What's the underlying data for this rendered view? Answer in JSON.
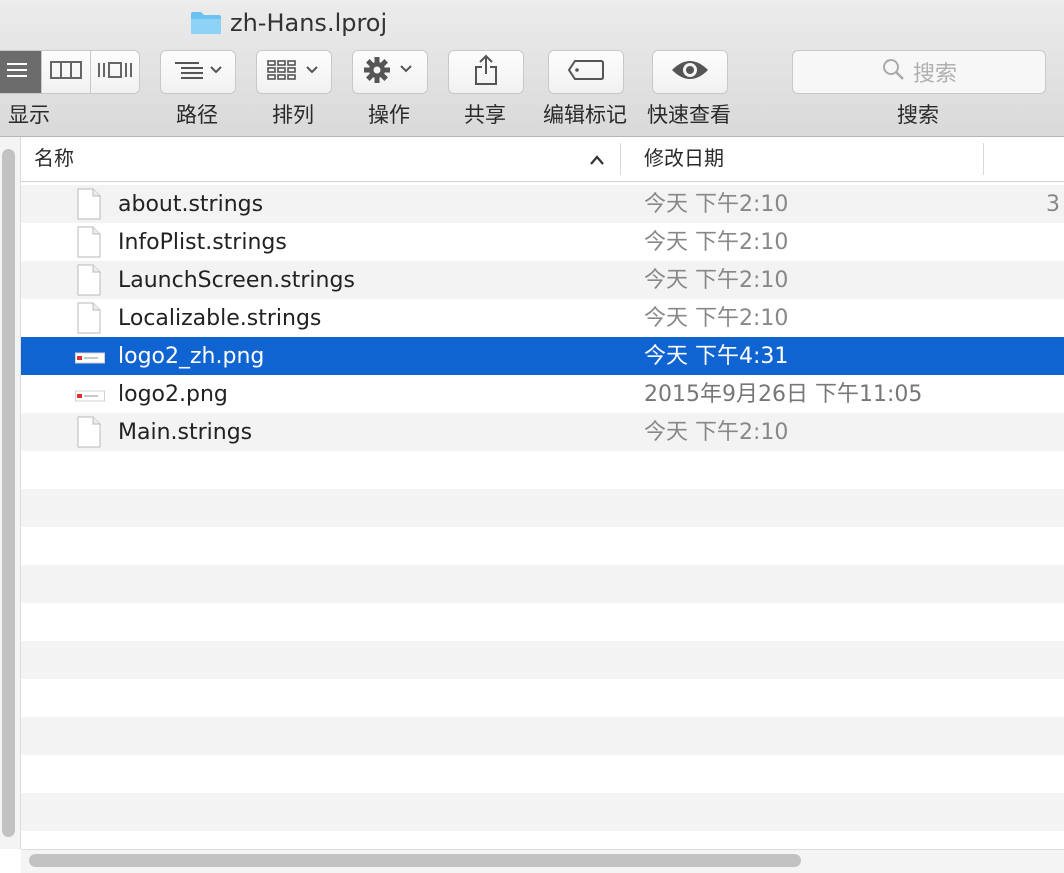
{
  "window": {
    "title": "zh-Hans.lproj"
  },
  "toolbar": {
    "view": {
      "label": "显示",
      "modes": [
        "list-view-icon",
        "column-view-icon",
        "coverflow-view-icon"
      ],
      "active_index": 0
    },
    "path": {
      "label": "路径",
      "icon": "path-list-icon"
    },
    "arrange": {
      "label": "排列",
      "icon": "grid-arrange-icon"
    },
    "action": {
      "label": "操作",
      "icon": "gear-icon"
    },
    "share": {
      "label": "共享",
      "icon": "share-icon"
    },
    "tags": {
      "label": "编辑标记",
      "icon": "tag-icon"
    },
    "quicklook": {
      "label": "快速查看",
      "icon": "eye-icon"
    },
    "search": {
      "label": "搜索",
      "placeholder": "搜索"
    }
  },
  "columns": {
    "name": "名称",
    "date": "修改日期",
    "sort": "ascending"
  },
  "files": [
    {
      "name": "about.strings",
      "date": "今天 下午2:10",
      "type": "document",
      "size_partial": "3"
    },
    {
      "name": "InfoPlist.strings",
      "date": "今天 下午2:10",
      "type": "document"
    },
    {
      "name": "LaunchScreen.strings",
      "date": "今天 下午2:10",
      "type": "document"
    },
    {
      "name": "Localizable.strings",
      "date": "今天 下午2:10",
      "type": "document"
    },
    {
      "name": "logo2_zh.png",
      "date": "今天 下午4:31",
      "type": "image",
      "selected": true
    },
    {
      "name": "logo2.png",
      "date": "2015年9月26日 下午11:05",
      "type": "image"
    },
    {
      "name": "Main.strings",
      "date": "今天 下午2:10",
      "type": "document"
    }
  ],
  "colors": {
    "selection": "#0f64d2",
    "folder": "#6cc1f0",
    "stripe": "#f3f3f3"
  }
}
